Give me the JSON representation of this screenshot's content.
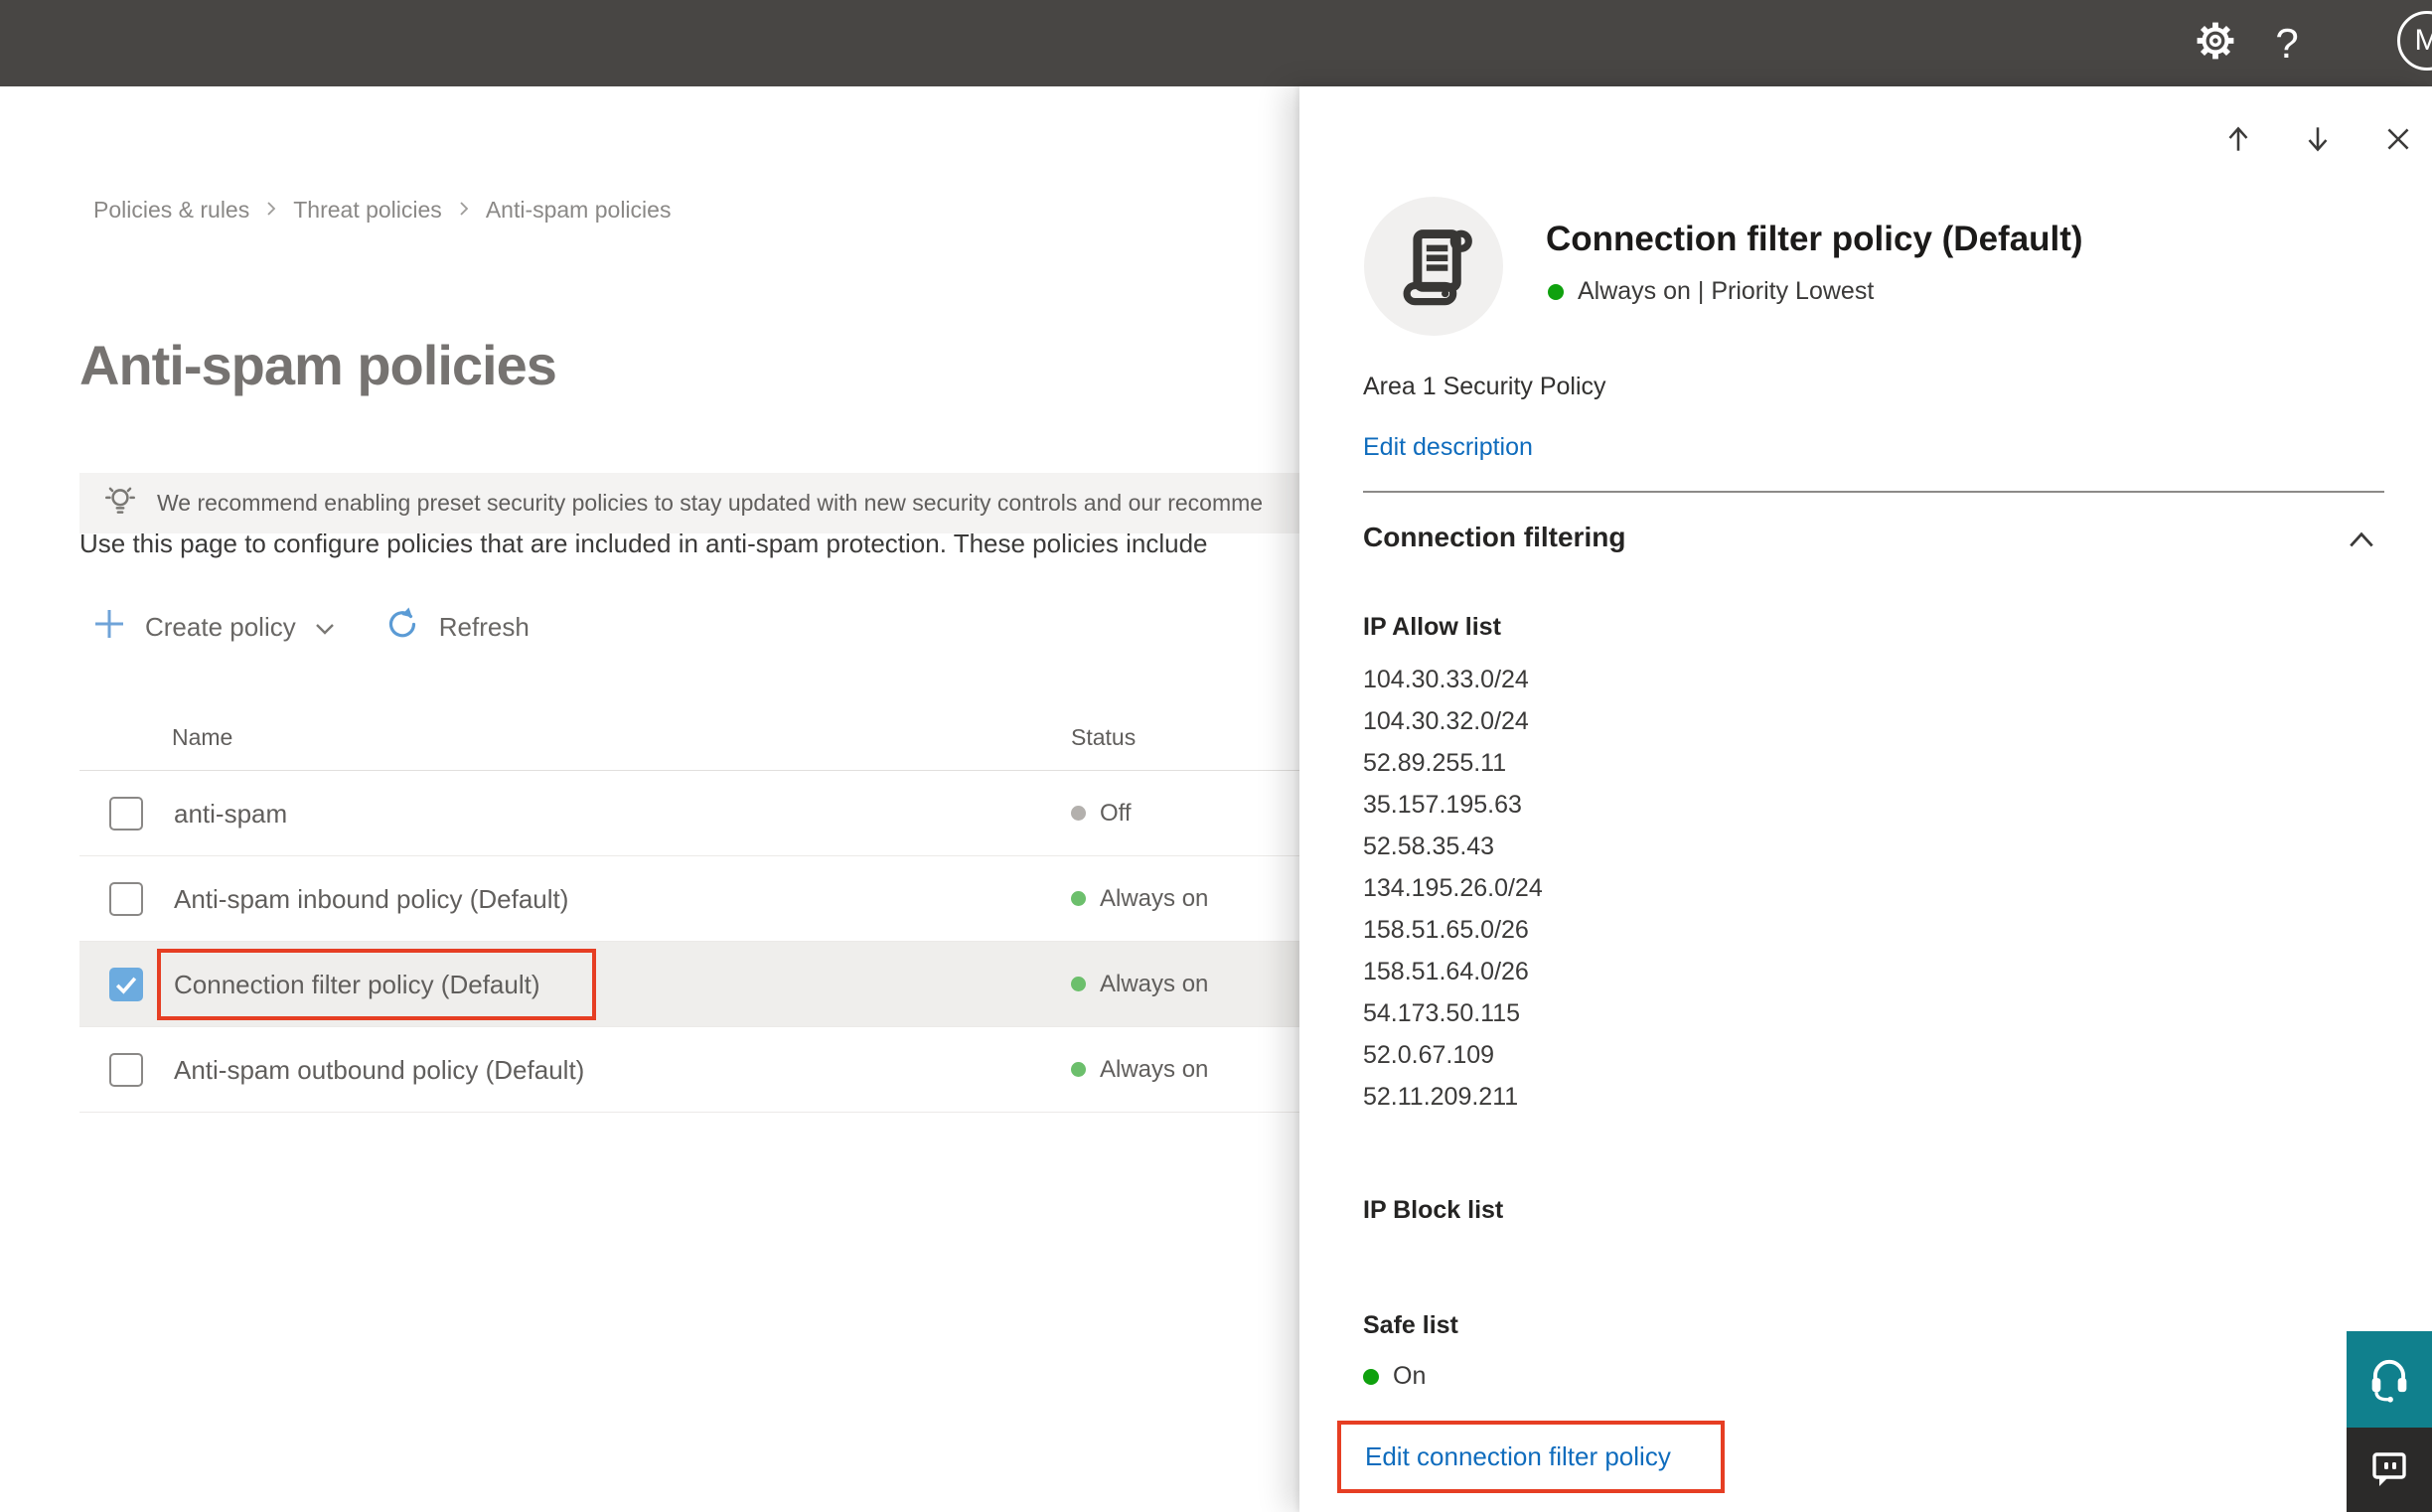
{
  "topbar": {
    "icons": [
      "gear-icon",
      "help-icon"
    ],
    "help_glyph": "?",
    "avatar_initial": "M"
  },
  "breadcrumb": {
    "items": [
      "Policies & rules",
      "Threat policies",
      "Anti-spam policies"
    ]
  },
  "page": {
    "title": "Anti-spam policies",
    "banner_text": "We recommend enabling preset security policies to stay updated with new security controls and our recomme",
    "description": "Use this page to configure policies that are included in anti-spam protection. These policies include",
    "toolbar": {
      "create_policy_label": "Create policy",
      "refresh_label": "Refresh"
    }
  },
  "table": {
    "columns": [
      "Name",
      "Status"
    ],
    "rows": [
      {
        "name": "anti-spam",
        "status": "Off",
        "checked": false,
        "selected": false,
        "highlighted": false
      },
      {
        "name": "Anti-spam inbound policy (Default)",
        "status": "Always on",
        "checked": false,
        "selected": false,
        "highlighted": false
      },
      {
        "name": "Connection filter policy (Default)",
        "status": "Always on",
        "checked": true,
        "selected": true,
        "highlighted": true
      },
      {
        "name": "Anti-spam outbound policy (Default)",
        "status": "Always on",
        "checked": false,
        "selected": false,
        "highlighted": false
      }
    ]
  },
  "flyout": {
    "nav_icons": [
      "arrow-up-icon",
      "arrow-down-icon",
      "close-icon"
    ],
    "title": "Connection filter policy (Default)",
    "status_line": "Always on | Priority Lowest",
    "description": "Area 1 Security Policy",
    "edit_description_label": "Edit description",
    "section_title": "Connection filtering",
    "ip_allow": {
      "heading": "IP Allow list",
      "items": [
        "104.30.33.0/24",
        "104.30.32.0/24",
        "52.89.255.11",
        "35.157.195.63",
        "52.58.35.43",
        "134.195.26.0/24",
        "158.51.65.0/26",
        "158.51.64.0/26",
        "54.173.50.115",
        "52.0.67.109",
        "52.11.209.211"
      ]
    },
    "ip_block": {
      "heading": "IP Block list"
    },
    "safe_list": {
      "heading": "Safe list",
      "status": "On"
    },
    "edit_link_label": "Edit connection filter policy"
  },
  "colors": {
    "topbar": "#484644",
    "accent_blue": "#0f6cbd",
    "icon_blue": "#5b9bd5",
    "green_bright": "#0fa10e",
    "green_soft": "#6cbf6c",
    "dot_gray": "#b3b0ad",
    "checkbox_blue": "#6cabdf",
    "red_outline": "#e63e23",
    "teal": "#10808d",
    "dark_btn": "#2b2a29",
    "selected_row": "#efeeec"
  }
}
